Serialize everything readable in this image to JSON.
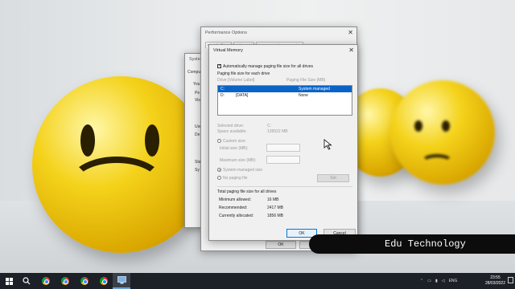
{
  "desktop": {
    "system_properties": {
      "title": "Syste",
      "tab": "Compu",
      "labels": [
        "You",
        "Pe",
        "Vis",
        "Use",
        "De",
        "Sta",
        "Sy"
      ]
    },
    "performance_options": {
      "title": "Performance Options",
      "tabs": [
        "Visual Effects",
        "Advanced",
        "Data Execution Prevention"
      ],
      "ok_label": "OK",
      "cancel_label": "Ca"
    },
    "virtual_memory": {
      "title": "Virtual Memory",
      "auto_manage_label": "Automatically manage paging file size for all drives",
      "auto_manage_checked": true,
      "section_label": "Paging file size for each drive",
      "col_drive": "Drive  [Volume Label]",
      "col_size": "Paging File Size (MB)",
      "drives": [
        {
          "drive": "C:",
          "label": "",
          "size": "System managed",
          "selected": true
        },
        {
          "drive": "D:",
          "label": "[DATA]",
          "size": "None",
          "selected": false
        }
      ],
      "selected_drive_label": "Selected drive:",
      "selected_drive_value": "C:",
      "space_available_label": "Space available:",
      "space_available_value": "139522 MB",
      "custom_size_label": "Custom size:",
      "initial_size_label": "Initial size (MB):",
      "maximum_size_label": "Maximum size (MB):",
      "system_managed_label": "System managed size",
      "no_paging_label": "No paging file",
      "set_label": "Set",
      "total_section_label": "Total paging file size for all drives",
      "minimum_allowed_label": "Minimum allowed:",
      "minimum_allowed_value": "16 MB",
      "recommended_label": "Recommended:",
      "recommended_value": "2417 MB",
      "currently_allocated_label": "Currently allocated:",
      "currently_allocated_value": "1856 MB",
      "ok_label": "OK",
      "cancel_label": "Cancel"
    },
    "banner_text": "Edu Technology"
  },
  "taskbar": {
    "start_icon": "windows-logo-icon",
    "search_icon": "search-icon",
    "apps": [
      "chrome-icon",
      "chrome-icon",
      "chrome-icon",
      "chrome-icon",
      "system-settings-icon"
    ],
    "tray_language": "ENG",
    "time": "23:55",
    "date": "28/03/2022"
  },
  "colors": {
    "selection_blue": "#0a64c8",
    "taskbar_bg": "#1c2127",
    "ok_border": "#0078d7"
  }
}
